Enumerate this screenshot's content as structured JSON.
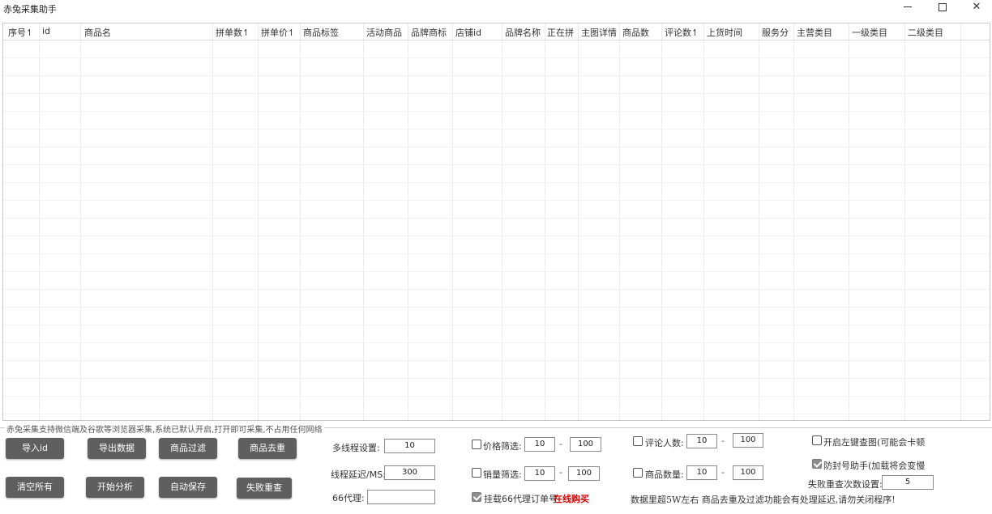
{
  "window": {
    "title": "赤兔采集助手"
  },
  "columns": [
    "序号↿",
    "id",
    "商品名",
    "拼单数↿",
    "拼单价↿",
    "商品标签",
    "活动商品",
    "品牌商标",
    "店铺id",
    "品牌名称",
    "正在拼",
    "主图详情",
    "商品数",
    "评论数↿",
    "上货时间",
    "服务分",
    "主营类目",
    "一级类目",
    "二级类目"
  ],
  "caption": "赤兔采集支持微信端及谷歌等浏览器采集,系统已默认开启,打开即可采集,不占用任何网络",
  "buttons": {
    "import_id": "导入id",
    "export_data": "导出数据",
    "filter_goods": "商品过滤",
    "dedupe_goods": "商品去重",
    "clear_all": "清空所有",
    "start_analysis": "开始分析",
    "auto_save": "自动保存",
    "retry_failed": "失败重查"
  },
  "settings": {
    "threads_label": "多线程设置:",
    "threads_value": "10",
    "delay_label": "线程延迟/MS:",
    "delay_value": "300",
    "proxy_label": "66代理:",
    "proxy_value": "",
    "price_label": "价格筛选:",
    "price_min": "10",
    "price_max": "100",
    "sales_label": "销量筛选:",
    "sales_min": "10",
    "sales_max": "100",
    "proxy_mount_label": "挂载66代理订单号",
    "buy_online": "在线购买",
    "reviewers_label": "评论人数:",
    "reviewers_min": "10",
    "reviewers_max": "100",
    "goods_qty_label": "商品数量:",
    "goods_qty_min": "10",
    "goods_qty_max": "100",
    "left_click_label": "开启左键查图(可能会卡顿",
    "anti_ban_label": "防封号助手(加载将会变慢",
    "retry_count_label": "失败重查次数设置:",
    "retry_count_value": "5",
    "dash": "-"
  },
  "notice": "数据里超5W左右  商品去重及过滤功能会有处理延迟,请勿关闭程序!",
  "checkboxes": {
    "price": false,
    "sales": false,
    "proxy_mount": true,
    "reviewers": false,
    "goods_qty": false,
    "left_click": false,
    "anti_ban": true
  }
}
